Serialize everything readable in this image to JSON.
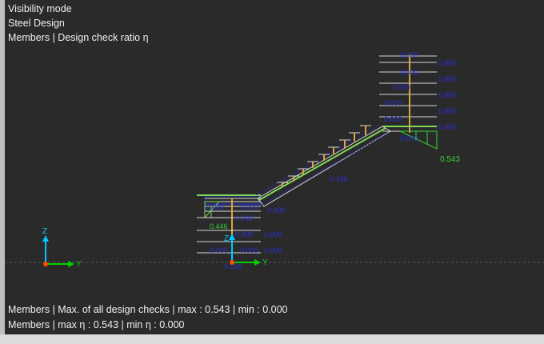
{
  "info": {
    "line1": "Visibility mode",
    "line2": "Steel Design",
    "line3": "Members | Design check ratio η"
  },
  "summary": {
    "line1": "Members | Max. of all design checks | max  : 0.543 | min  : 0.000",
    "line2": "Members | max η : 0.543 | min η : 0.000"
  },
  "scene": {
    "max_ratio_label": "0.543",
    "stringer_label": "0.199",
    "left_landing_label": "0.446",
    "colors": {
      "background": "#2a2a2a",
      "member_white": "#d8d8d8",
      "member_orange": "#d9a441",
      "member_green": "#7ed957",
      "diagram_blue": "#2a2fd8",
      "max_green": "#35d235",
      "axis_x": "#00d000",
      "axis_z": "#00c8ff",
      "origin": "#ff4d00"
    },
    "axes_small": {
      "z_label": "Z",
      "y_label": "Y"
    },
    "axes_model": {
      "z_label": "Z",
      "y_label": "Y"
    }
  }
}
